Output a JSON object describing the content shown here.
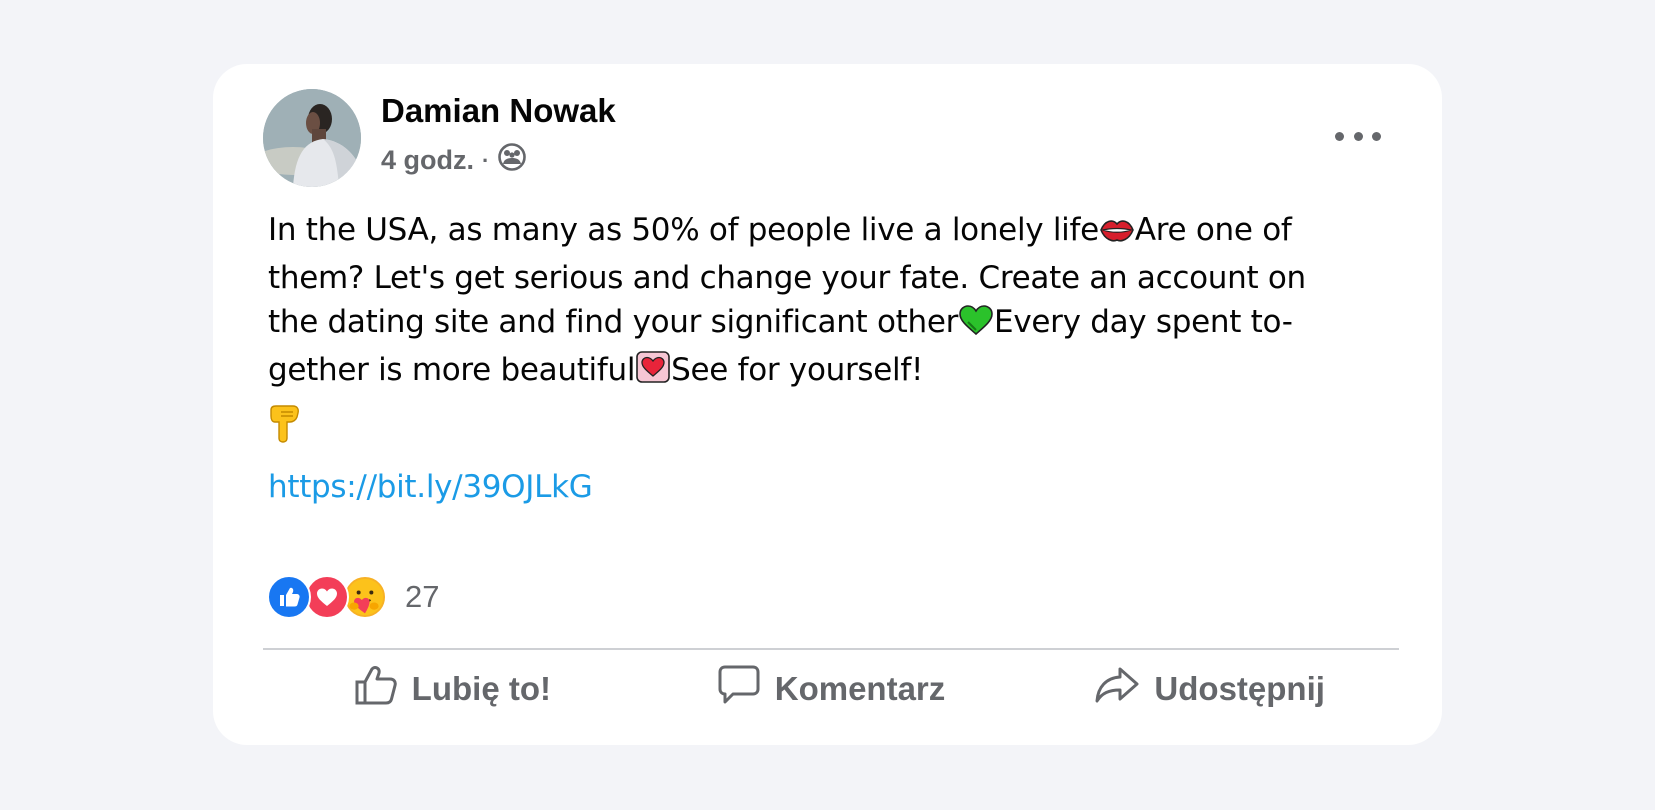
{
  "post": {
    "author": "Damian Nowak",
    "time": "4 godz.",
    "separator": "·",
    "privacy_icon": "friends-group-icon",
    "text": {
      "line1_a": "In the USA, as many as 50% of people live a lonely life",
      "line1_b": "Are one of",
      "line2": "them? Let's get serious and change your fate. Create an account on",
      "line3_a": "the dating site and find your significant other",
      "line3_b": "Every day spent to-",
      "line4_a": "gether is more beautiful",
      "line4_b": "See for yourself!"
    },
    "link": "https://bit.ly/39OJLkG",
    "reactions": {
      "icons": [
        "like-reaction-icon",
        "love-reaction-icon",
        "care-reaction-icon"
      ],
      "count": "27"
    },
    "actions": {
      "like": "Lubię to!",
      "comment": "Komentarz",
      "share": "Udostępnij"
    }
  },
  "colors": {
    "background": "#f3f4f8",
    "card": "#ffffff",
    "link": "#1b9be6",
    "secondary_text": "#65676b",
    "like_blue": "#1877f2",
    "love_red": "#f33e58"
  }
}
